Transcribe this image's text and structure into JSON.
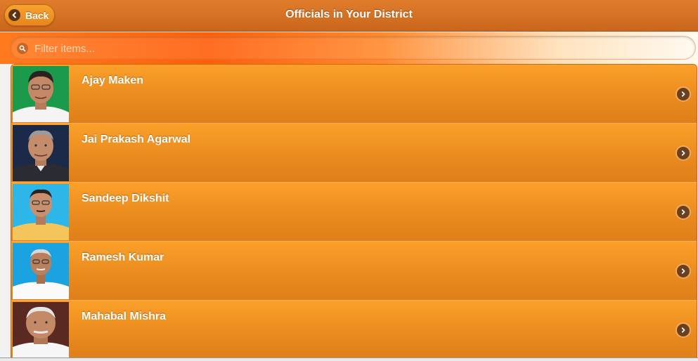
{
  "header": {
    "title": "Officials in Your District",
    "back_label": "Back"
  },
  "filter": {
    "placeholder": "Filter items..."
  },
  "officials": [
    {
      "name": "Ajay Maken"
    },
    {
      "name": "Jai Prakash Agarwal"
    },
    {
      "name": "Sandeep Dikshit"
    },
    {
      "name": "Ramesh Kumar"
    },
    {
      "name": "Mahabal Mishra"
    }
  ],
  "icons": {
    "back": "arrow-left-icon",
    "filter": "search-icon",
    "row": "chevron-right-icon"
  },
  "colors": {
    "header": "#d4731f",
    "row": "#f39623",
    "accent": "#ff5e0a"
  }
}
